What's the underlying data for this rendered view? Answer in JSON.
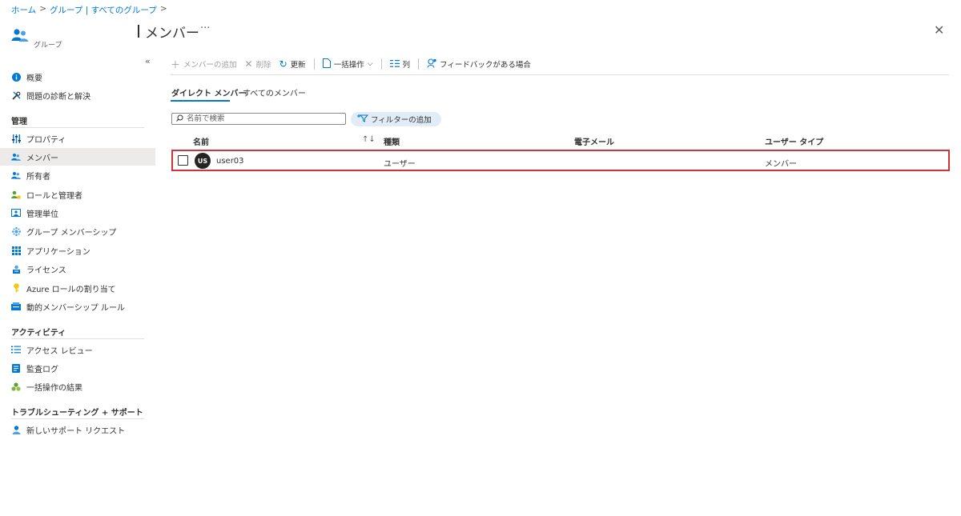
{
  "breadcrumb": {
    "home": "ホーム",
    "groups": "グループ | すべてのグループ",
    "sep": ">"
  },
  "sidebar": {
    "subtitle": "グループ",
    "collapse": "«",
    "top_items": [
      {
        "label": "概要",
        "icon": "info-icon"
      },
      {
        "label": "問題の診断と解決",
        "icon": "wrench-icon"
      }
    ],
    "section_manage": "管理",
    "manage_items": [
      {
        "label": "プロパティ",
        "icon": "properties-icon"
      },
      {
        "label": "メンバー",
        "icon": "members-icon"
      },
      {
        "label": "所有者",
        "icon": "owners-icon"
      },
      {
        "label": "ロールと管理者",
        "icon": "roles-icon"
      },
      {
        "label": "管理単位",
        "icon": "admin-units-icon"
      },
      {
        "label": "グループ メンバーシップ",
        "icon": "group-membership-icon"
      },
      {
        "label": "アプリケーション",
        "icon": "apps-grid-icon"
      },
      {
        "label": "ライセンス",
        "icon": "license-icon"
      },
      {
        "label": "Azure ロールの割り当て",
        "icon": "key-icon"
      },
      {
        "label": "動的メンバーシップ ルール",
        "icon": "dynamic-rules-icon"
      }
    ],
    "section_activity": "アクティビティ",
    "activity_items": [
      {
        "label": "アクセス レビュー",
        "icon": "access-review-icon"
      },
      {
        "label": "監査ログ",
        "icon": "audit-log-icon"
      },
      {
        "label": "一括操作の結果",
        "icon": "bulk-results-icon"
      }
    ],
    "section_support": "トラブルシューティング + サポート",
    "support_items": [
      {
        "label": "新しいサポート リクエスト",
        "icon": "support-request-icon"
      }
    ]
  },
  "header": {
    "title": "メンバー",
    "more": "···",
    "close": "✕"
  },
  "toolbar": {
    "add_member": "メンバーの追加",
    "delete": "削除",
    "refresh": "更新",
    "bulk": "一括操作",
    "columns": "列",
    "feedback": "フィードバックがある場合"
  },
  "tabs": {
    "direct": "ダイレクト メンバー",
    "all": "すべてのメンバー"
  },
  "search": {
    "placeholder": "名前で検索",
    "value": ""
  },
  "filter": {
    "label": "フィルターの追加"
  },
  "table": {
    "columns": {
      "name": "名前",
      "type": "種類",
      "email": "電子メール",
      "user_type": "ユーザー タイプ"
    },
    "rows": [
      {
        "initials": "US",
        "name": "user03",
        "type": "ユーザー",
        "email": "",
        "user_type": "メンバー"
      }
    ]
  },
  "colors": {
    "accent": "#0078d4",
    "highlight_border": "#d13438",
    "active_nav": "#edebe9"
  }
}
